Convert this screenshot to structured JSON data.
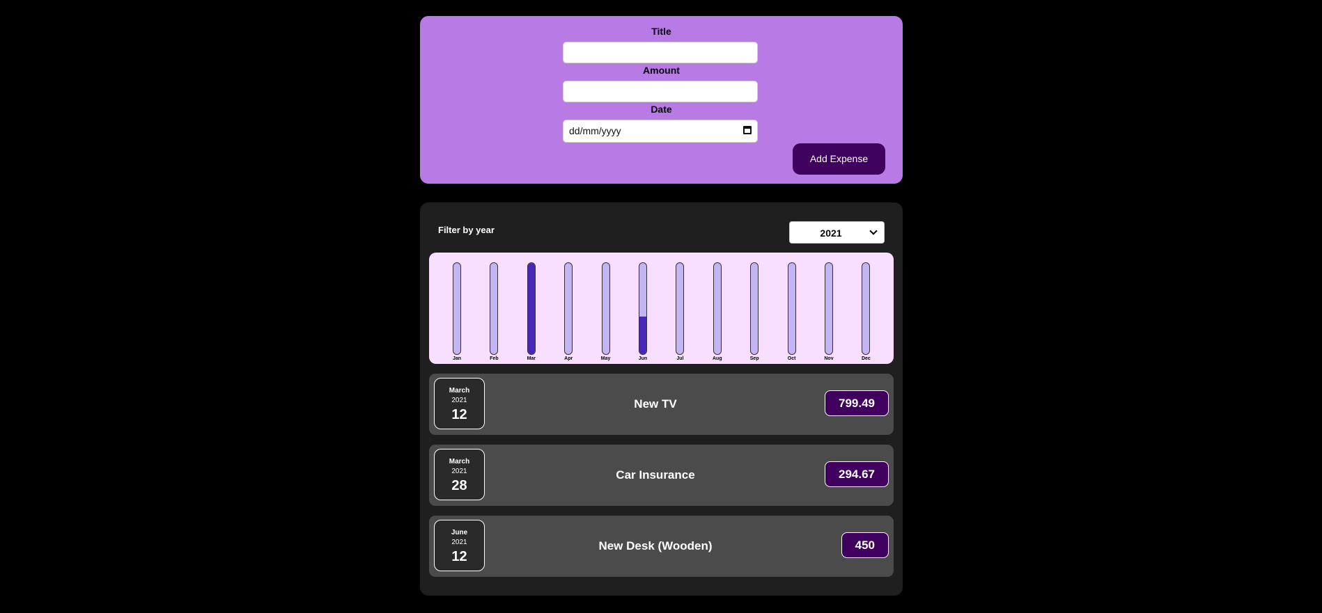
{
  "form": {
    "title_label": "Title",
    "title_value": "",
    "amount_label": "Amount",
    "amount_value": "",
    "date_label": "Date",
    "date_placeholder": "dd/mm/yyyy",
    "submit_label": "Add Expense"
  },
  "filter": {
    "label": "Filter by year",
    "selected_year": "2021"
  },
  "chart_data": {
    "type": "bar",
    "categories": [
      "Jan",
      "Feb",
      "Mar",
      "Apr",
      "May",
      "Jun",
      "Jul",
      "Aug",
      "Sep",
      "Oct",
      "Nov",
      "Dec"
    ],
    "values": [
      0,
      0,
      1094.16,
      0,
      0,
      450,
      0,
      0,
      0,
      0,
      0,
      0
    ],
    "ylim": [
      0,
      1094.16
    ]
  },
  "expenses": [
    {
      "month": "March",
      "year": "2021",
      "day": "12",
      "title": "New TV",
      "amount": "799.49"
    },
    {
      "month": "March",
      "year": "2021",
      "day": "28",
      "title": "Car Insurance",
      "amount": "294.67"
    },
    {
      "month": "June",
      "year": "2021",
      "day": "12",
      "title": "New Desk (Wooden)",
      "amount": "450"
    }
  ],
  "colors": {
    "background": "#000000",
    "form_card": "#b87ae5",
    "accent": "#40005d",
    "chart_bg": "#f8dfff",
    "bar_track": "#c3b4f3",
    "bar_fill": "#4826b9",
    "expense_item": "#4b4b4b"
  }
}
